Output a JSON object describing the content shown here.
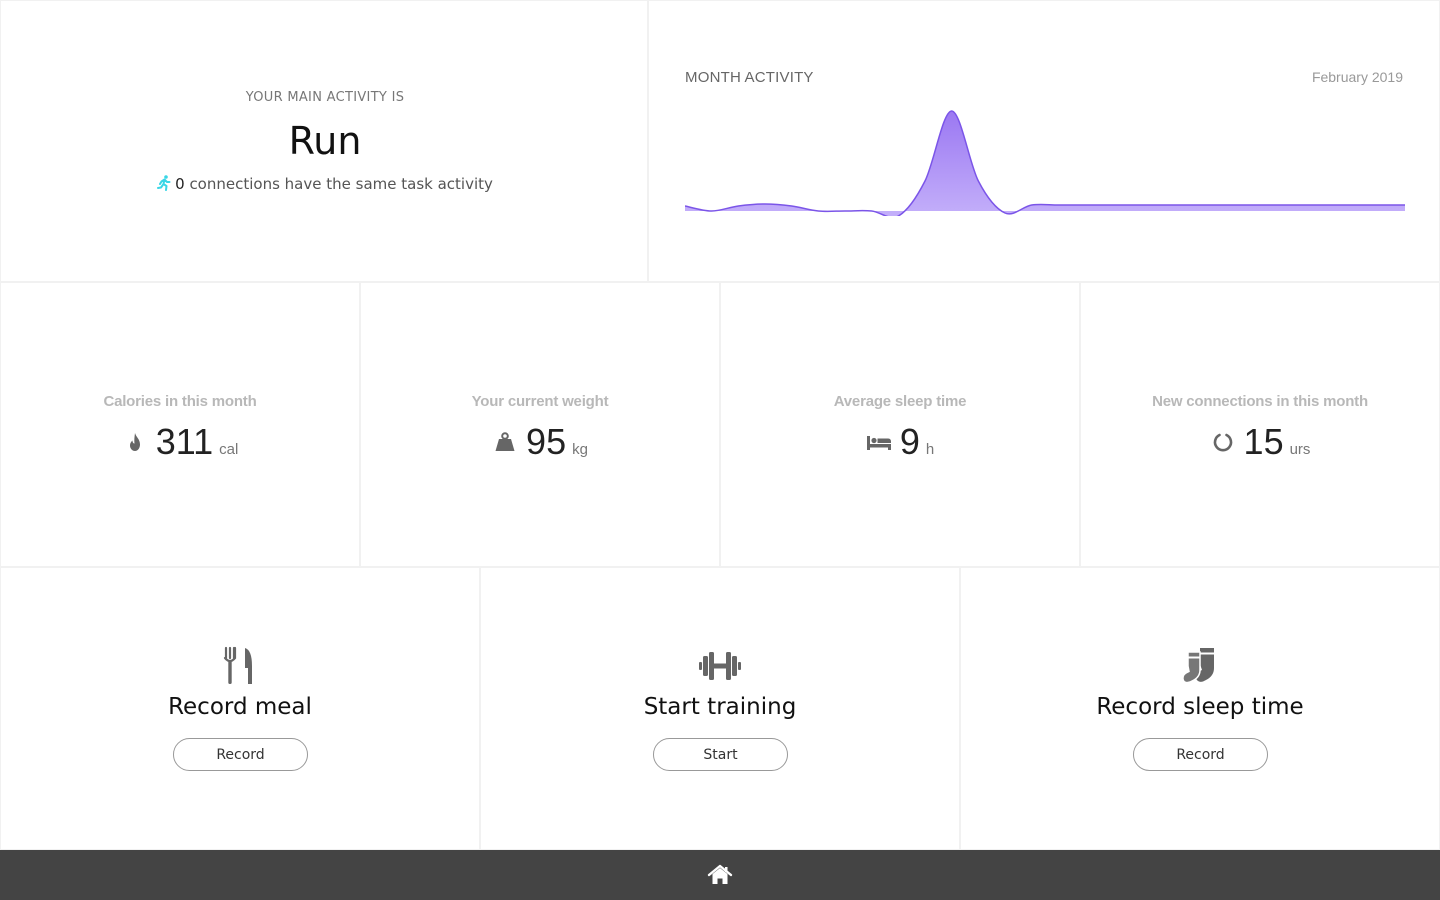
{
  "main_activity": {
    "label": "YOUR MAIN ACTIVITY IS",
    "activity": "Run",
    "connections_count": "0",
    "connections_text": " connections have the same task activity",
    "icon": "running-icon",
    "icon_color": "#3ad6e6"
  },
  "month_activity": {
    "title": "MONTH ACTIVITY",
    "date": "February 2019"
  },
  "chart_data": {
    "type": "area",
    "title": "MONTH ACTIVITY",
    "x": [
      1,
      2,
      3,
      4,
      5,
      6,
      7,
      8,
      9,
      10,
      11,
      12,
      13,
      14,
      15,
      16,
      17,
      18,
      19,
      20,
      21,
      22,
      23,
      24,
      25,
      26,
      27,
      28
    ],
    "series": [
      {
        "values": [
          0.05,
          0,
          0.05,
          0.07,
          0.05,
          0,
          0,
          0,
          -0.05,
          0.3,
          1.0,
          0.3,
          -0.02,
          0.06,
          0.06,
          0.06,
          0.06,
          0.06,
          0.06,
          0.06,
          0.06,
          0.06,
          0.06,
          0.06,
          0.06,
          0.06,
          0.06,
          0.06
        ]
      }
    ],
    "ylim": [
      0,
      1
    ],
    "grid": false,
    "fill_color": "#a98df5",
    "line_color": "#7b55e8"
  },
  "stats": {
    "calories": {
      "label": "Calories in this month",
      "value": "311",
      "unit": "cal",
      "icon": "flame-icon"
    },
    "weight": {
      "label": "Your current weight",
      "value": "95",
      "unit": "kg",
      "icon": "weight-icon"
    },
    "sleep": {
      "label": "Average sleep time",
      "value": "9",
      "unit": "h",
      "icon": "bed-icon"
    },
    "connections": {
      "label": "New connections in this month",
      "value": "15",
      "unit": "urs",
      "icon": "circle-notch-icon"
    }
  },
  "actions": {
    "meal": {
      "title": "Record meal",
      "button": "Record",
      "icon": "utensils-icon"
    },
    "training": {
      "title": "Start training",
      "button": "Start",
      "icon": "dumbbell-icon"
    },
    "sleep": {
      "title": "Record sleep time",
      "button": "Record",
      "icon": "socks-icon"
    }
  },
  "bottom_bar": {
    "icon": "home-icon",
    "color": "#444444"
  }
}
